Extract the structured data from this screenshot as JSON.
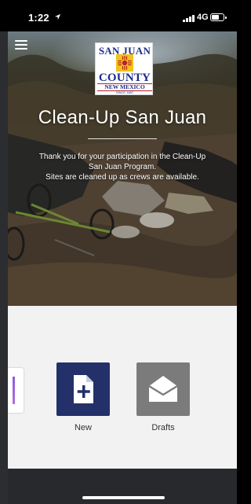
{
  "status_bar": {
    "time": "1:22",
    "network": "4G"
  },
  "header": {
    "menu_icon": "hamburger-menu-icon",
    "logo": {
      "top_text": "SAN JUAN",
      "county_text": "COUNTY",
      "state_text": "NEW MEXICO",
      "since_text": "SINCE 1887"
    },
    "title": "Clean-Up San Juan",
    "message_lines": [
      "Thank you for your participation in the Clean-Up",
      "San Juan Program.",
      "Sites are cleaned up as crews are available."
    ]
  },
  "tiles": [
    {
      "label": "New",
      "icon": "new-document-icon",
      "color": "#24306a"
    },
    {
      "label": "Drafts",
      "icon": "envelope-open-icon",
      "color": "#7b7b7b"
    }
  ],
  "colors": {
    "accent_navy": "#24306a",
    "logo_blue": "#1d2e8c",
    "logo_red": "#b8202a",
    "logo_yellow": "#f2c21b"
  }
}
